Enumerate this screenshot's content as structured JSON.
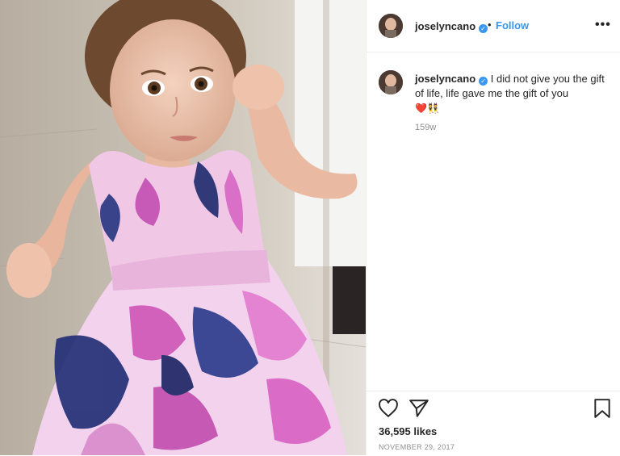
{
  "post": {
    "username": "joselyncano",
    "verified_icon": "verified-badge-icon",
    "separator": "•",
    "follow_label": "Follow",
    "more_icon": "more-options-icon",
    "more_label": "•••"
  },
  "caption": {
    "username": "joselyncano",
    "text": " I did not give you the gift of life, life gave me the gift of you",
    "emojis": "❤️👯",
    "time": "159w"
  },
  "actions": {
    "like_icon": "heart-icon",
    "share_icon": "send-icon",
    "save_icon": "bookmark-icon",
    "likes": "36,595 likes",
    "date": "NOVEMBER 29, 2017"
  },
  "colors": {
    "accent": "#3897f0",
    "text": "#262626",
    "muted": "#8e8e8e"
  }
}
